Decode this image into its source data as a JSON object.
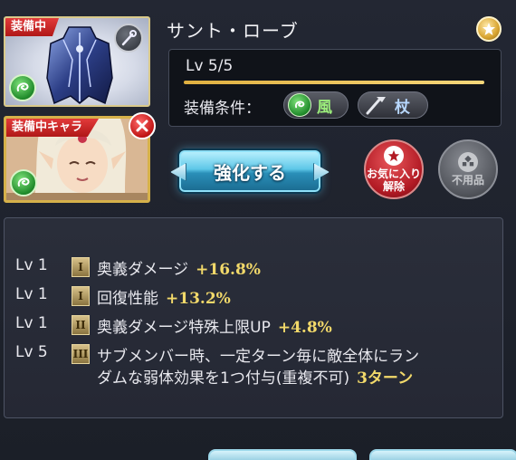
{
  "item": {
    "name": "サント・ローブ",
    "equipped_tag": "装備中",
    "level_text": "Lv 5/5",
    "level_progress": 1.0,
    "condition_label": "装備条件：",
    "element": "風",
    "weapon_type": "杖"
  },
  "character": {
    "equipped_tag": "装備中キャラ"
  },
  "actions": {
    "upgrade": "強化する",
    "unfavorite": [
      "お気に入り",
      "解除"
    ],
    "unneeded": "不用品"
  },
  "skills": [
    {
      "level": "Lv 1",
      "tier": "I",
      "description": "奥義ダメージ",
      "value": "+16.8%"
    },
    {
      "level": "Lv 1",
      "tier": "I",
      "description": "回復性能",
      "value": "+13.2%"
    },
    {
      "level": "Lv 1",
      "tier": "II",
      "description": "奥義ダメージ特殊上限UP",
      "value": "+4.8%"
    },
    {
      "level": "Lv 5",
      "tier": "III",
      "description_line1": "サブメンバー時、一定ターン毎に敵全体にラン",
      "description_line2": "ダムな弱体効果を1つ付与(重複不可)",
      "value": "3ターン"
    }
  ],
  "colors": {
    "accent_gold": "#f2d96a",
    "wind_green": "#9df07c",
    "equip_red": "#c81e1e",
    "upgrade_blue": "#5ec8e8"
  }
}
